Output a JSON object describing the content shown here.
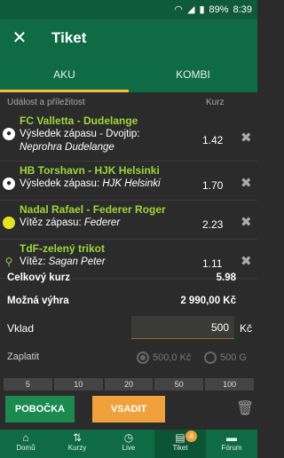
{
  "status": {
    "battery": "89%",
    "time": "8:39"
  },
  "appbar": {
    "title": "Tiket"
  },
  "tabs": [
    {
      "label": "AKU"
    },
    {
      "label": "KOMBI"
    }
  ],
  "colhdr": {
    "event": "Událost a příležitost",
    "odds": "Kurz"
  },
  "bets": [
    {
      "match": "FC Valletta - Dudelange",
      "market": "Výsledek zápasu - Dvojtip:",
      "selection": "Neprohra Dudelange",
      "odds": "1.42",
      "sport_icon": "football-icon"
    },
    {
      "match": "HB Torshavn - HJK Helsinki",
      "market": "Výsledek zápasu:",
      "selection": "HJK Helsinki",
      "odds": "1.70",
      "sport_icon": "football-icon"
    },
    {
      "match": "Nadal Rafael - Federer Roger",
      "market": "Vítěz zápasu:",
      "selection": "Federer",
      "odds": "2.23",
      "sport_icon": "tennis-ball-icon"
    },
    {
      "match": "TdF-zelený trikot",
      "market": "Vítěz:",
      "selection": "Sagan Peter",
      "odds": "1.11",
      "sport_icon": "cycling-icon"
    }
  ],
  "totals": {
    "total_odds_label": "Celkový kurz",
    "total_odds": "5.98",
    "win_label": "Možná výhra",
    "win": "2 990,00 Kč"
  },
  "stake": {
    "label": "Vklad",
    "value": "500",
    "currency": "Kč"
  },
  "pay": {
    "label": "Zaplatit",
    "opt1": "500,0 Kč",
    "opt2": "500 G"
  },
  "quick": [
    "5",
    "10",
    "20",
    "50",
    "100"
  ],
  "actions": {
    "branch": "POBOČKA",
    "bet": "VSADIT"
  },
  "nav": [
    {
      "label": "Domů"
    },
    {
      "label": "Kurzy"
    },
    {
      "label": "Live"
    },
    {
      "label": "Tiket",
      "badge": "4"
    },
    {
      "label": "Fórum"
    }
  ]
}
